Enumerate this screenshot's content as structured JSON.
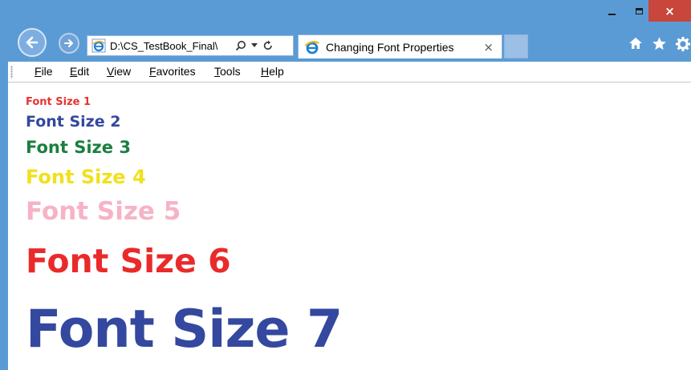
{
  "window": {
    "caption_buttons": [
      "minimize",
      "maximize",
      "close"
    ],
    "close_glyph": "×",
    "accent_color": "#5b9bd5"
  },
  "nav": {
    "back_icon": "back-arrow-icon",
    "forward_icon": "forward-arrow-icon",
    "address_value": "D:\\CS_TestBook_Final\\",
    "address_icons": [
      "search-icon",
      "dropdown-icon",
      "refresh-icon"
    ],
    "tab_title": "Changing Font Properties",
    "tab_close": "×",
    "toolbar_icons": [
      "home-icon",
      "favorites-star-icon",
      "settings-gear-icon"
    ]
  },
  "menu": {
    "items": [
      "File",
      "Edit",
      "View",
      "Favorites",
      "Tools",
      "Help"
    ]
  },
  "content": {
    "lines": [
      {
        "text": "Font Size 1",
        "color": "#e8322f"
      },
      {
        "text": "Font Size 2",
        "color": "#33489e"
      },
      {
        "text": "Font Size 3",
        "color": "#1a7f3f"
      },
      {
        "text": "Font Size 4",
        "color": "#f0e11c"
      },
      {
        "text": "Font Size 5",
        "color": "#f6b3c5"
      },
      {
        "text": "Font Size 6",
        "color": "#ea2a2a"
      },
      {
        "text": "Font Size 7",
        "color": "#33489e"
      }
    ]
  }
}
